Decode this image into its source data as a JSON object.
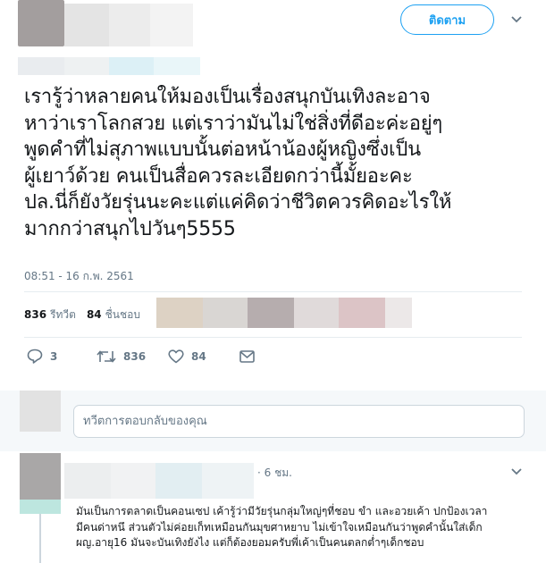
{
  "header": {
    "follow_label": "ติดตาม",
    "caret_icon": "chevron-down-icon"
  },
  "tweet": {
    "text_lines": [
      "เรารู้ว่าหลายคนให้มองเป็นเรื่องสนุกบันเทิงละอาจ",
      "หาว่าเราโลกสวย แต่เราว่ามันไม่ใช่สิ่งที่ดีอะค่ะอยู่ๆ",
      "พูดคำที่ไม่สุภาพแบบนั้นต่อหน้าน้องผู้หญิงซึ่งเป็น",
      "ผู้เยาว์ด้วย คนเป็นสื่อควรละเอียดกว่านี้มั้ยอะคะ",
      "ปล.นี่ก็ยังวัยรุ่นนะคะแต่แค่คิดว่าชีวิตควรคิดอะไรให้",
      "มากกว่าสนุกไปวันๆ5555"
    ],
    "timestamp": "08:51 - 16 ก.พ. 2561",
    "stats": {
      "retweets_count": "836",
      "retweets_label": "รีทวีต",
      "likes_count": "84",
      "likes_label": "ชื่นชอบ"
    },
    "actions": {
      "reply_count": "3",
      "retweet_count": "836",
      "like_count": "84"
    }
  },
  "reply_box": {
    "placeholder": "ทวีตการตอบกลับของคุณ"
  },
  "reply": {
    "time": "· 6 ชม.",
    "text_lines": [
      "มันเป็นการตลาดเป็นคอนเซป เค้ารู้ว่ามีวัยรุ่นกลุ่มใหญ่ๆที่ชอบ ขำ และอวยเค้า ปกป้องเวลา",
      "มีคนด่าหนึ ส่วนตัวไม่ค่อยเก็ทเหมือนกันมุขศาหยาบ ไม่เข้าใจเหมือนกันว่าพูดคำนั้นใส่เด็ก",
      "ผญ.อายุ16 มันจะบันเทิงยังไง แต่ก็ต้องยอมครับพี่เค้าเป็นคนตลกต่ำๆเด็กชอบ"
    ]
  },
  "colors": {
    "accent": "#1da1f2",
    "muted": "#657786",
    "text": "#14171a",
    "divider": "#e6ecf0"
  }
}
